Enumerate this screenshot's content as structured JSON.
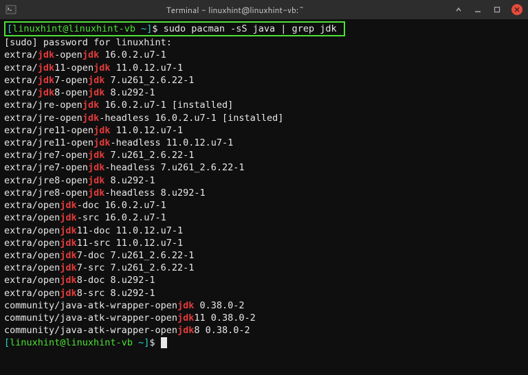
{
  "titlebar": {
    "title": "Terminal - linuxhint@linuxhint-vb:~"
  },
  "prompt": {
    "open_bracket": "[",
    "user": "linuxhint@linuxhint-vb",
    "path": " ~",
    "close_bracket": "]",
    "dollar": "$ "
  },
  "command": "sudo pacman -sS java | grep jdk",
  "sudo_line": "[sudo] password for linuxhint:",
  "results": [
    {
      "prefix": "extra/",
      "pre": "",
      "hl": "jdk",
      "post": "-open",
      "hl2": "jdk",
      "rest": " 16.0.2.u7-1"
    },
    {
      "prefix": "extra/",
      "pre": "",
      "hl": "jdk",
      "post": "11-open",
      "hl2": "jdk",
      "rest": " 11.0.12.u7-1"
    },
    {
      "prefix": "extra/",
      "pre": "",
      "hl": "jdk",
      "post": "7-open",
      "hl2": "jdk",
      "rest": " 7.u261_2.6.22-1"
    },
    {
      "prefix": "extra/",
      "pre": "",
      "hl": "jdk",
      "post": "8-open",
      "hl2": "jdk",
      "rest": " 8.u292-1"
    },
    {
      "prefix": "extra/",
      "pre": "jre-open",
      "hl": "jdk",
      "post": "",
      "hl2": "",
      "rest": " 16.0.2.u7-1 [installed]"
    },
    {
      "prefix": "extra/",
      "pre": "jre-open",
      "hl": "jdk",
      "post": "-headless",
      "hl2": "",
      "rest": " 16.0.2.u7-1 [installed]"
    },
    {
      "prefix": "extra/",
      "pre": "jre11-open",
      "hl": "jdk",
      "post": "",
      "hl2": "",
      "rest": " 11.0.12.u7-1"
    },
    {
      "prefix": "extra/",
      "pre": "jre11-open",
      "hl": "jdk",
      "post": "-headless",
      "hl2": "",
      "rest": " 11.0.12.u7-1"
    },
    {
      "prefix": "extra/",
      "pre": "jre7-open",
      "hl": "jdk",
      "post": "",
      "hl2": "",
      "rest": " 7.u261_2.6.22-1"
    },
    {
      "prefix": "extra/",
      "pre": "jre7-open",
      "hl": "jdk",
      "post": "-headless",
      "hl2": "",
      "rest": " 7.u261_2.6.22-1"
    },
    {
      "prefix": "extra/",
      "pre": "jre8-open",
      "hl": "jdk",
      "post": "",
      "hl2": "",
      "rest": " 8.u292-1"
    },
    {
      "prefix": "extra/",
      "pre": "jre8-open",
      "hl": "jdk",
      "post": "-headless",
      "hl2": "",
      "rest": " 8.u292-1"
    },
    {
      "prefix": "extra/",
      "pre": "open",
      "hl": "jdk",
      "post": "-doc",
      "hl2": "",
      "rest": " 16.0.2.u7-1"
    },
    {
      "prefix": "extra/",
      "pre": "open",
      "hl": "jdk",
      "post": "-src",
      "hl2": "",
      "rest": " 16.0.2.u7-1"
    },
    {
      "prefix": "extra/",
      "pre": "open",
      "hl": "jdk",
      "post": "11-doc",
      "hl2": "",
      "rest": " 11.0.12.u7-1"
    },
    {
      "prefix": "extra/",
      "pre": "open",
      "hl": "jdk",
      "post": "11-src",
      "hl2": "",
      "rest": " 11.0.12.u7-1"
    },
    {
      "prefix": "extra/",
      "pre": "open",
      "hl": "jdk",
      "post": "7-doc",
      "hl2": "",
      "rest": " 7.u261_2.6.22-1"
    },
    {
      "prefix": "extra/",
      "pre": "open",
      "hl": "jdk",
      "post": "7-src",
      "hl2": "",
      "rest": " 7.u261_2.6.22-1"
    },
    {
      "prefix": "extra/",
      "pre": "open",
      "hl": "jdk",
      "post": "8-doc",
      "hl2": "",
      "rest": " 8.u292-1"
    },
    {
      "prefix": "extra/",
      "pre": "open",
      "hl": "jdk",
      "post": "8-src",
      "hl2": "",
      "rest": " 8.u292-1"
    },
    {
      "prefix": "community/",
      "pre": "java-atk-wrapper-open",
      "hl": "jdk",
      "post": "",
      "hl2": "",
      "rest": " 0.38.0-2"
    },
    {
      "prefix": "community/",
      "pre": "java-atk-wrapper-open",
      "hl": "jdk",
      "post": "11",
      "hl2": "",
      "rest": " 0.38.0-2"
    },
    {
      "prefix": "community/",
      "pre": "java-atk-wrapper-open",
      "hl": "jdk",
      "post": "8",
      "hl2": "",
      "rest": " 0.38.0-2"
    }
  ]
}
